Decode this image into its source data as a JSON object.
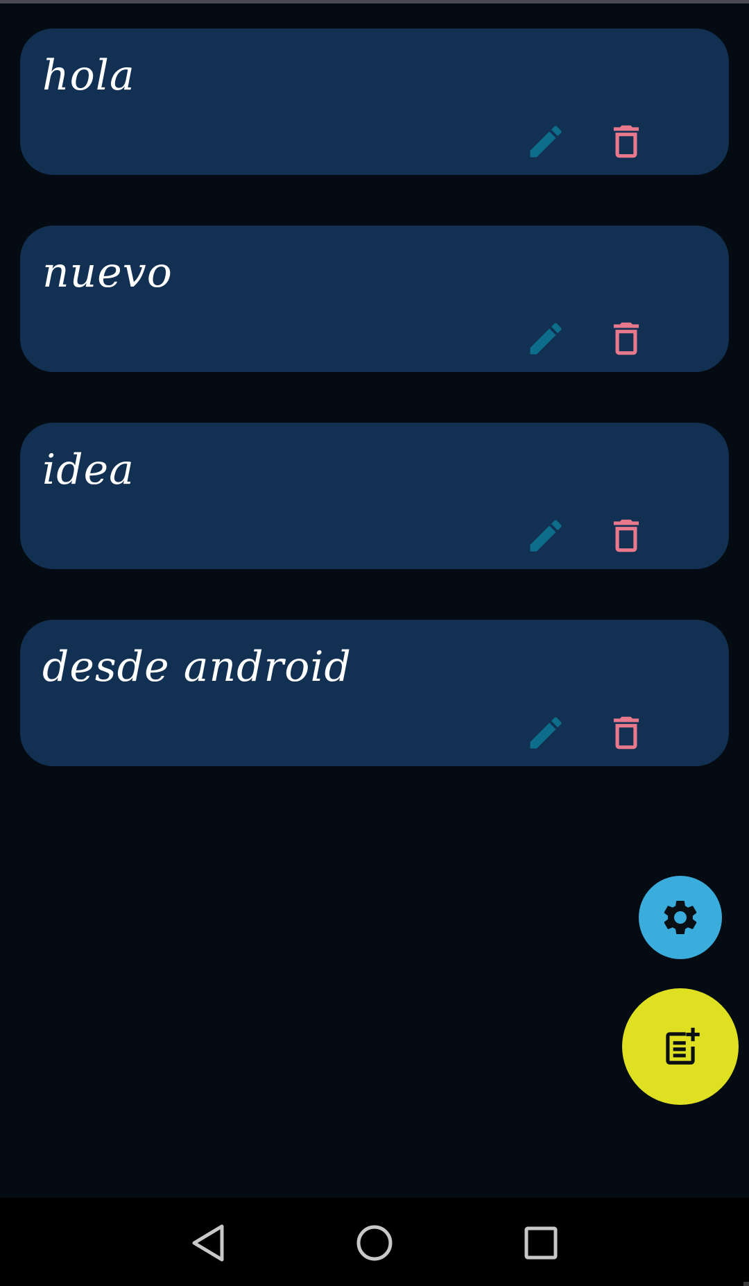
{
  "notes": [
    {
      "title": "hola"
    },
    {
      "title": "nuevo"
    },
    {
      "title": "idea"
    },
    {
      "title": "desde android"
    }
  ],
  "icons": {
    "edit": "pencil-icon",
    "delete": "trash-icon",
    "settings": "gear-icon",
    "add_note": "add-note-icon",
    "nav_back": "back-triangle-icon",
    "nav_home": "home-circle-icon",
    "nav_recents": "recents-square-icon"
  },
  "colors": {
    "background": "#050b12",
    "card": "#123152",
    "edit_icon": "#0e6d8a",
    "delete_icon": "#e8788c",
    "settings_fab": "#3aaddd",
    "add_fab": "#dee021",
    "nav_icons": "#c8c8c8"
  }
}
